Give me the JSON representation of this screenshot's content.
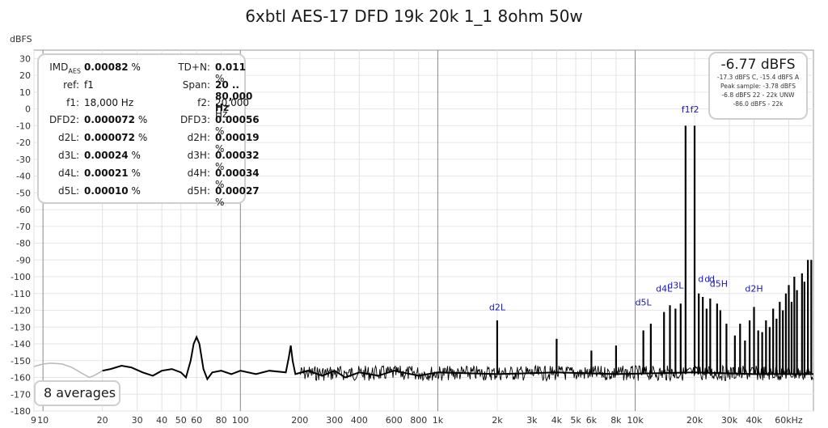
{
  "chart_data": {
    "type": "line",
    "title": "6xbtl AES-17 DFD 19k 20k 1_1 8ohm 50w",
    "ylabel": "dBFS",
    "xlabel": "",
    "xscale": "log",
    "xlim": [
      9,
      80000
    ],
    "ylim": [
      -180,
      35
    ],
    "grid": true,
    "y_ticks": [
      "30",
      "20",
      "10",
      "0",
      "-10",
      "-20",
      "-30",
      "-40",
      "-50",
      "-60",
      "-70",
      "-80",
      "-90",
      "-100",
      "-110",
      "-120",
      "-130",
      "-140",
      "-150",
      "-160",
      "-170",
      "-180"
    ],
    "x_ticks": [
      {
        "v": 9,
        "t": "9"
      },
      {
        "v": 10,
        "t": "10"
      },
      {
        "v": 20,
        "t": "20"
      },
      {
        "v": 30,
        "t": "30"
      },
      {
        "v": 40,
        "t": "40"
      },
      {
        "v": 50,
        "t": "50"
      },
      {
        "v": 60,
        "t": "60"
      },
      {
        "v": 80,
        "t": "80"
      },
      {
        "v": 100,
        "t": "100"
      },
      {
        "v": 200,
        "t": "200"
      },
      {
        "v": 300,
        "t": "300"
      },
      {
        "v": 400,
        "t": "400"
      },
      {
        "v": 600,
        "t": "600"
      },
      {
        "v": 800,
        "t": "800"
      },
      {
        "v": 1000,
        "t": "1k"
      },
      {
        "v": 2000,
        "t": "2k"
      },
      {
        "v": 3000,
        "t": "3k"
      },
      {
        "v": 4000,
        "t": "4k"
      },
      {
        "v": 5000,
        "t": "5k"
      },
      {
        "v": 6000,
        "t": "6k"
      },
      {
        "v": 8000,
        "t": "8k"
      },
      {
        "v": 10000,
        "t": "10k"
      },
      {
        "v": 20000,
        "t": "20k"
      },
      {
        "v": 30000,
        "t": "30k"
      },
      {
        "v": 40000,
        "t": "40k"
      },
      {
        "v": 60000,
        "t": "60kHz"
      }
    ],
    "low_freq_gray_curve": [
      {
        "x": 9,
        "y": -153.5
      },
      {
        "x": 10,
        "y": -152
      },
      {
        "x": 11,
        "y": -151.5
      },
      {
        "x": 12.5,
        "y": -152
      },
      {
        "x": 14,
        "y": -154
      },
      {
        "x": 16,
        "y": -158
      },
      {
        "x": 17.2,
        "y": -160
      },
      {
        "x": 18.4,
        "y": -158.5
      },
      {
        "x": 20,
        "y": -156
      }
    ],
    "noise_floor_curve": [
      {
        "x": 20,
        "y": -156
      },
      {
        "x": 22,
        "y": -155
      },
      {
        "x": 25,
        "y": -153
      },
      {
        "x": 28,
        "y": -154
      },
      {
        "x": 32,
        "y": -157
      },
      {
        "x": 36,
        "y": -159
      },
      {
        "x": 40,
        "y": -156
      },
      {
        "x": 45,
        "y": -155
      },
      {
        "x": 50,
        "y": -157
      },
      {
        "x": 53,
        "y": -160
      },
      {
        "x": 56,
        "y": -150
      },
      {
        "x": 58,
        "y": -140
      },
      {
        "x": 60,
        "y": -136
      },
      {
        "x": 62,
        "y": -140
      },
      {
        "x": 65,
        "y": -155
      },
      {
        "x": 68,
        "y": -161
      },
      {
        "x": 72,
        "y": -157
      },
      {
        "x": 80,
        "y": -156
      },
      {
        "x": 90,
        "y": -158
      },
      {
        "x": 100,
        "y": -156
      },
      {
        "x": 120,
        "y": -158
      },
      {
        "x": 140,
        "y": -156
      },
      {
        "x": 170,
        "y": -157
      },
      {
        "x": 176,
        "y": -148
      },
      {
        "x": 180,
        "y": -141
      },
      {
        "x": 184,
        "y": -150
      },
      {
        "x": 190,
        "y": -158
      },
      {
        "x": 220,
        "y": -156
      },
      {
        "x": 260,
        "y": -159
      },
      {
        "x": 300,
        "y": -156
      },
      {
        "x": 340,
        "y": -160
      },
      {
        "x": 400,
        "y": -157
      },
      {
        "x": 500,
        "y": -159
      },
      {
        "x": 600,
        "y": -156
      },
      {
        "x": 800,
        "y": -159
      },
      {
        "x": 1000,
        "y": -157
      },
      {
        "x": 2000,
        "y": -158
      },
      {
        "x": 4000,
        "y": -157
      },
      {
        "x": 8000,
        "y": -158
      },
      {
        "x": 20000,
        "y": -157
      },
      {
        "x": 40000,
        "y": -158
      },
      {
        "x": 80000,
        "y": -158
      }
    ],
    "noise_band": {
      "from": 200,
      "to": 80000,
      "top": -153,
      "bottom": -162
    },
    "spikes": [
      {
        "x": 2000,
        "y": -126
      },
      {
        "x": 4000,
        "y": -137
      },
      {
        "x": 6000,
        "y": -144
      },
      {
        "x": 8000,
        "y": -141
      },
      {
        "x": 11000,
        "y": -132
      },
      {
        "x": 12000,
        "y": -128
      },
      {
        "x": 14000,
        "y": -121
      },
      {
        "x": 15000,
        "y": -117
      },
      {
        "x": 16000,
        "y": -119
      },
      {
        "x": 17000,
        "y": -116
      },
      {
        "x": 18000,
        "y": -10
      },
      {
        "x": 20000,
        "y": -10
      },
      {
        "x": 21000,
        "y": -110
      },
      {
        "x": 22000,
        "y": -112
      },
      {
        "x": 23000,
        "y": -119
      },
      {
        "x": 24000,
        "y": -113
      },
      {
        "x": 26000,
        "y": -116
      },
      {
        "x": 27000,
        "y": -120
      },
      {
        "x": 29000,
        "y": -128
      },
      {
        "x": 32000,
        "y": -135
      },
      {
        "x": 34000,
        "y": -128
      },
      {
        "x": 36000,
        "y": -138
      },
      {
        "x": 38000,
        "y": -126
      },
      {
        "x": 40000,
        "y": -118
      },
      {
        "x": 42000,
        "y": -132
      },
      {
        "x": 44000,
        "y": -133
      },
      {
        "x": 46000,
        "y": -126
      },
      {
        "x": 48000,
        "y": -130
      },
      {
        "x": 50000,
        "y": -119
      },
      {
        "x": 52000,
        "y": -125
      },
      {
        "x": 54000,
        "y": -115
      },
      {
        "x": 56000,
        "y": -120
      },
      {
        "x": 58000,
        "y": -110
      },
      {
        "x": 60000,
        "y": -105
      },
      {
        "x": 62000,
        "y": -115
      },
      {
        "x": 64000,
        "y": -100
      },
      {
        "x": 66000,
        "y": -108
      },
      {
        "x": 70000,
        "y": -98
      },
      {
        "x": 72000,
        "y": -103
      },
      {
        "x": 75000,
        "y": -90
      },
      {
        "x": 78000,
        "y": -90
      }
    ],
    "peak_labels": [
      {
        "x": 2000,
        "y": -120,
        "t": "d2L"
      },
      {
        "x": 11000,
        "y": -117,
        "t": "d5L"
      },
      {
        "x": 14000,
        "y": -109,
        "t": "d4L"
      },
      {
        "x": 16000,
        "y": -107,
        "t": "d3L"
      },
      {
        "x": 19000,
        "y": -2,
        "t": "f1f2"
      },
      {
        "x": 21500,
        "y": -103,
        "t": "d"
      },
      {
        "x": 23200,
        "y": -103,
        "t": "d"
      },
      {
        "x": 24500,
        "y": -103,
        "t": "d"
      },
      {
        "x": 26500,
        "y": -106,
        "t": "d5H"
      },
      {
        "x": 40000,
        "y": -109,
        "t": "d2H"
      }
    ]
  },
  "stats": [
    {
      "l1": "IMD",
      "l1sub": "AES",
      "v1": "0.00082",
      "u1": " %",
      "l2": "TD+N:",
      "v2": "0.011",
      "u2": " %"
    },
    {
      "l1": "ref:",
      "l1sub": "",
      "v1": "f1",
      "u1": "",
      "l2": "Span:",
      "v2": "20 .. 80,000 Hz",
      "u2": ""
    },
    {
      "l1": "f1:",
      "l1sub": "",
      "v1": "18,000 Hz",
      "u1": "",
      "l2": "f2:",
      "v2": "20,000 Hz",
      "u2": ""
    },
    {
      "l1": "DFD2:",
      "l1sub": "",
      "v1": "0.000072",
      "u1": " %",
      "l2": "DFD3:",
      "v2": "0.00056",
      "u2": " %"
    },
    {
      "l1": "d2L:",
      "l1sub": "",
      "v1": "0.000072",
      "u1": " %",
      "l2": "d2H:",
      "v2": "0.00019",
      "u2": " %"
    },
    {
      "l1": "d3L:",
      "l1sub": "",
      "v1": "0.00024",
      "u1": " %",
      "l2": "d3H:",
      "v2": "0.00032",
      "u2": " %"
    },
    {
      "l1": "d4L:",
      "l1sub": "",
      "v1": "0.00021",
      "u1": " %",
      "l2": "d4H:",
      "v2": "0.00034",
      "u2": " %"
    },
    {
      "l1": "d5L:",
      "l1sub": "",
      "v1": "0.00010",
      "u1": " %",
      "l2": "d5H:",
      "v2": "0.00027",
      "u2": " %"
    }
  ],
  "level": {
    "main": "-6.77 dBFS",
    "lines": [
      "-17.3 dBFS C, -15.4 dBFS A",
      "Peak sample: -3.78 dBFS",
      "-6.8 dBFS 22 - 22k UNW",
      "-86.0 dBFS - 22k"
    ]
  },
  "averages": "8 averages"
}
